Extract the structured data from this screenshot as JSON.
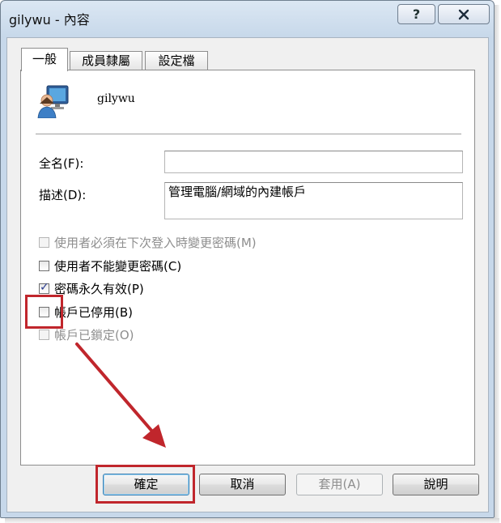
{
  "window": {
    "title": "gilywu - 內容",
    "help_label": "?"
  },
  "tabs": [
    {
      "label": "一般",
      "active": true
    },
    {
      "label": "成員隸屬",
      "active": false
    },
    {
      "label": "設定檔",
      "active": false
    }
  ],
  "user": {
    "name": "gilywu",
    "icon": "user-computer-icon"
  },
  "fields": {
    "fullname_label": "全名(F):",
    "fullname_value": "",
    "description_label": "描述(D):",
    "description_value": "管理電腦/網域的內建帳戶"
  },
  "options": [
    {
      "label": "使用者必須在下次登入時變更密碼(M)",
      "checked": false,
      "enabled": false
    },
    {
      "label": "使用者不能變更密碼(C)",
      "checked": false,
      "enabled": true
    },
    {
      "label": "密碼永久有效(P)",
      "checked": true,
      "enabled": true
    },
    {
      "label": "帳戶已停用(B)",
      "checked": false,
      "enabled": true
    },
    {
      "label": "帳戶已鎖定(O)",
      "checked": false,
      "enabled": false
    }
  ],
  "buttons": {
    "ok": "確定",
    "cancel": "取消",
    "apply": "套用(A)",
    "help": "說明"
  },
  "colors": {
    "annotation": "#c0262c",
    "check": "#2a3c8e"
  }
}
